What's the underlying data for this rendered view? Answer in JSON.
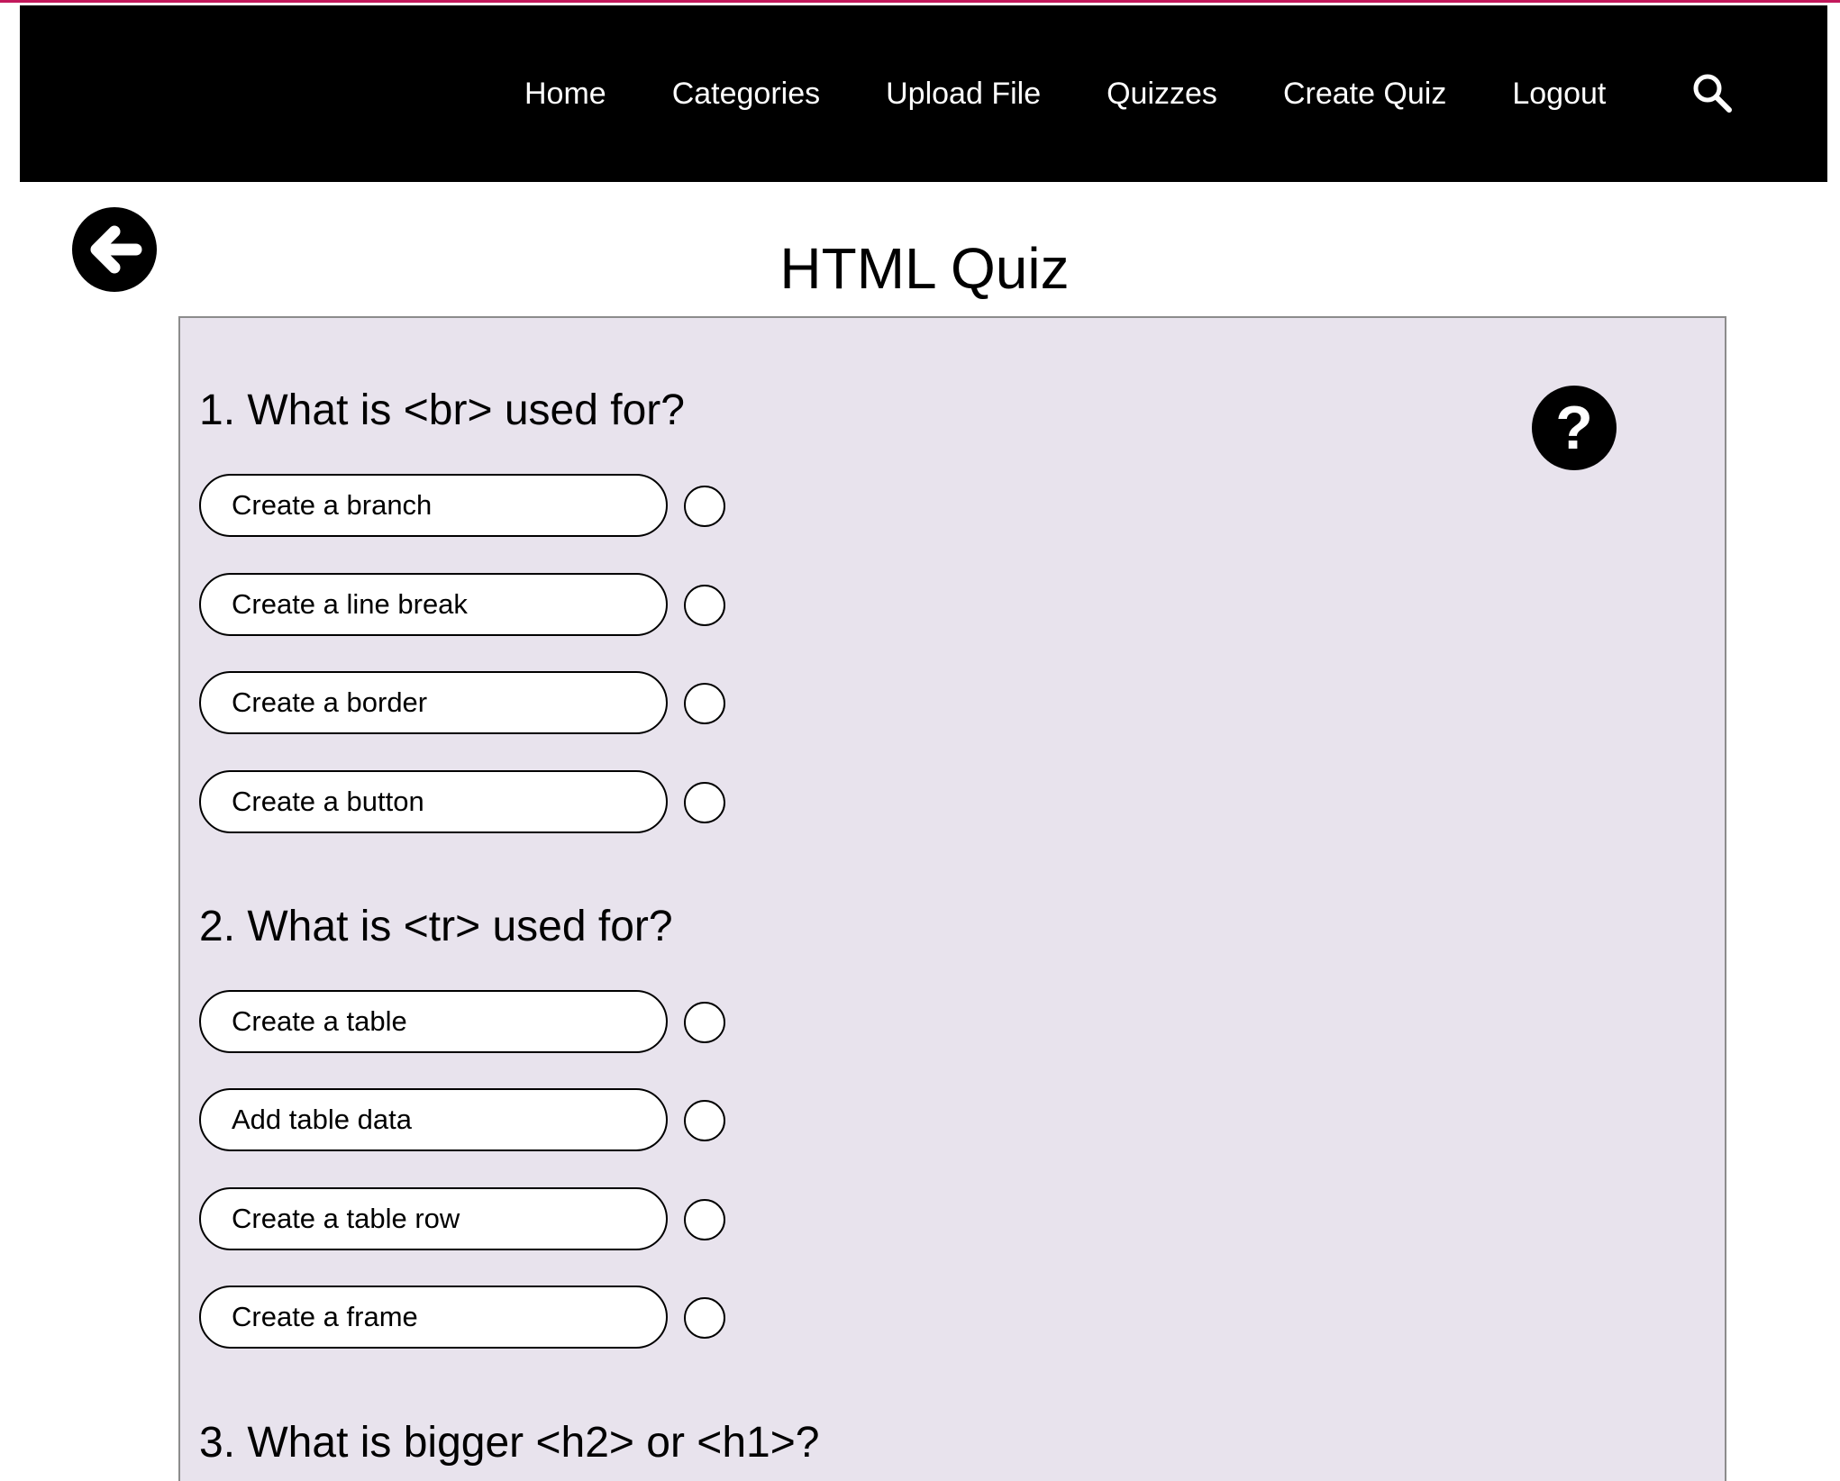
{
  "nav": {
    "links": [
      "Home",
      "Categories",
      "Upload File",
      "Quizzes",
      "Create Quiz",
      "Logout"
    ],
    "search_icon": "search-icon"
  },
  "page": {
    "title": "HTML Quiz",
    "back_icon": "arrow-left-icon",
    "help_label": "?"
  },
  "questions": [
    {
      "text": "1. What is <br> used for?",
      "options": [
        "Create a branch",
        "Create a line break",
        "Create a border",
        "Create a button"
      ]
    },
    {
      "text": "2. What is <tr> used for?",
      "options": [
        "Create a table",
        "Add table data",
        "Create a table row",
        "Create a frame"
      ]
    },
    {
      "text": "3. What is bigger <h2> or <h1>?",
      "options": []
    }
  ],
  "colors": {
    "navbar_bg": "#000000",
    "panel_bg": "#e8e3ed",
    "accent_line": "#c2185b"
  }
}
